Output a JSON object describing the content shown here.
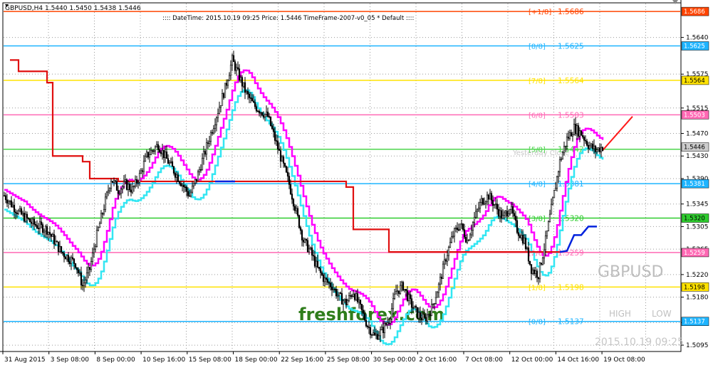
{
  "header": {
    "symbol_line": "GBPUSD,H4  1.5440 1.5450 1.5438 1.5446",
    "info_line": ":::: DateTime: 2015.10.19 09:25    Price: 1.5446    TimeFrame-2007-v0_05    *   Default ::::"
  },
  "watermark": {
    "brand": "freshforex.com",
    "symbol": "GBPUSD",
    "high_label": "HIGH",
    "low_label": "LOW",
    "timestamp": "2015.10.19 09:25",
    "yest_label": "Yesterday Close"
  },
  "y_axis": {
    "ticks": [
      "1.5640",
      "1.5575",
      "1.5515",
      "1.5470",
      "1.5430",
      "1.5390",
      "1.5345",
      "1.5305",
      "1.5265",
      "1.5220",
      "1.5180",
      "1.5135",
      "1.5095"
    ]
  },
  "murrey_levels": [
    {
      "label": "[+1/8]",
      "value": "1.5686",
      "color": "#ff4500"
    },
    {
      "label": "[8/8]",
      "value": "1.5625",
      "color": "#1eb4ff"
    },
    {
      "label": "[7/8]",
      "value": "1.5564",
      "color": "#ffe200"
    },
    {
      "label": "[6/8]",
      "value": "1.5503",
      "color": "#ff69b4"
    },
    {
      "label": "[5/8]",
      "value": "1.5442",
      "color": "#4cd54c"
    },
    {
      "label": "[4/8]",
      "value": "1.5381",
      "color": "#1eb4ff"
    },
    {
      "label": "[3/8]",
      "value": "1.5320",
      "color": "#2ecc2e"
    },
    {
      "label": "[2/8]",
      "value": "1.5259",
      "color": "#ff69b4"
    },
    {
      "label": "[1/8]",
      "value": "1.5198",
      "color": "#ffe200"
    },
    {
      "label": "[0/8]",
      "value": "1.5137",
      "color": "#1eb4ff"
    }
  ],
  "axis_price_labels": [
    {
      "value": "1.5686",
      "bg": "#ff4500",
      "fg": "#ffffff"
    },
    {
      "value": "1.5625",
      "bg": "#1eb4ff",
      "fg": "#ffffff"
    },
    {
      "value": "1.5564",
      "bg": "#ffe200",
      "fg": "#000000"
    },
    {
      "value": "1.5503",
      "bg": "#ff69b4",
      "fg": "#ffffff"
    },
    {
      "value": "1.5446",
      "bg": "#cccccc",
      "fg": "#000000"
    },
    {
      "value": "1.5381",
      "bg": "#1eb4ff",
      "fg": "#ffffff"
    },
    {
      "value": "1.5320",
      "bg": "#2ecc2e",
      "fg": "#000000"
    },
    {
      "value": "1.5259",
      "bg": "#ff69b4",
      "fg": "#ffffff"
    },
    {
      "value": "1.5198",
      "bg": "#ffe200",
      "fg": "#000000"
    },
    {
      "value": "1.5137",
      "bg": "#1eb4ff",
      "fg": "#ffffff"
    }
  ],
  "x_axis": {
    "ticks": [
      "31 Aug 2015",
      "3 Sep 08:00",
      "8 Sep 00:00",
      "10 Sep 16:00",
      "15 Sep 08:00",
      "18 Sep 00:00",
      "22 Sep 16:00",
      "25 Sep 08:00",
      "30 Sep 00:00",
      "2 Oct 16:00",
      "7 Oct 08:00",
      "12 Oct 00:00",
      "14 Oct 16:00",
      "19 Oct 08:00"
    ]
  },
  "chart_data": {
    "type": "candlestick",
    "symbol": "GBPUSD",
    "timeframe": "H4",
    "ylim": [
      1.5085,
      1.57
    ],
    "last_price": 1.5446,
    "indicator_colors": {
      "red_line": "#e01010",
      "magenta_line": "#ff00ff",
      "cyan_line": "#33e6f2",
      "blue_segment": "#0022dd"
    },
    "close_path": [
      [
        0,
        1.536
      ],
      [
        10,
        1.533
      ],
      [
        20,
        1.531
      ],
      [
        30,
        1.53
      ],
      [
        40,
        1.526
      ],
      [
        50,
        1.524
      ],
      [
        55,
        1.52
      ],
      [
        60,
        1.523
      ],
      [
        65,
        1.529
      ],
      [
        70,
        1.534
      ],
      [
        75,
        1.539
      ],
      [
        80,
        1.537
      ],
      [
        85,
        1.538
      ],
      [
        90,
        1.537
      ],
      [
        95,
        1.5395
      ],
      [
        100,
        1.543
      ],
      [
        108,
        1.545
      ],
      [
        115,
        1.542
      ],
      [
        120,
        1.54
      ],
      [
        125,
        1.538
      ],
      [
        130,
        1.536
      ],
      [
        135,
        1.539
      ],
      [
        140,
        1.543
      ],
      [
        145,
        1.547
      ],
      [
        150,
        1.551
      ],
      [
        155,
        1.555
      ],
      [
        160,
        1.56
      ],
      [
        165,
        1.557
      ],
      [
        170,
        1.554
      ],
      [
        175,
        1.552
      ],
      [
        180,
        1.551
      ],
      [
        185,
        1.55
      ],
      [
        190,
        1.546
      ],
      [
        195,
        1.542
      ],
      [
        200,
        1.538
      ],
      [
        205,
        1.533
      ],
      [
        210,
        1.528
      ],
      [
        215,
        1.526
      ],
      [
        220,
        1.523
      ],
      [
        225,
        1.521
      ],
      [
        230,
        1.52
      ],
      [
        235,
        1.518
      ],
      [
        240,
        1.517
      ],
      [
        245,
        1.519
      ],
      [
        250,
        1.516
      ],
      [
        255,
        1.513
      ],
      [
        260,
        1.511
      ],
      [
        265,
        1.512
      ],
      [
        270,
        1.514
      ],
      [
        275,
        1.519
      ],
      [
        280,
        1.52
      ],
      [
        285,
        1.517
      ],
      [
        290,
        1.515
      ],
      [
        295,
        1.514
      ],
      [
        300,
        1.516
      ],
      [
        305,
        1.52
      ],
      [
        310,
        1.525
      ],
      [
        315,
        1.529
      ],
      [
        320,
        1.531
      ],
      [
        325,
        1.528
      ],
      [
        330,
        1.532
      ],
      [
        335,
        1.535
      ],
      [
        340,
        1.536
      ],
      [
        345,
        1.534
      ],
      [
        350,
        1.532
      ],
      [
        355,
        1.534
      ],
      [
        360,
        1.53
      ],
      [
        365,
        1.528
      ],
      [
        370,
        1.523
      ],
      [
        375,
        1.522
      ],
      [
        380,
        1.528
      ],
      [
        385,
        1.535
      ],
      [
        390,
        1.542
      ],
      [
        395,
        1.546
      ],
      [
        400,
        1.548
      ],
      [
        405,
        1.547
      ],
      [
        410,
        1.545
      ],
      [
        415,
        1.544
      ],
      [
        420,
        1.5446
      ]
    ]
  }
}
